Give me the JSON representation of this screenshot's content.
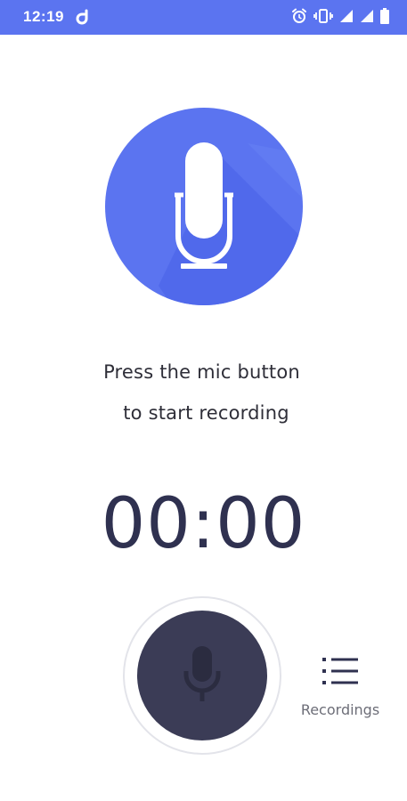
{
  "status_bar": {
    "time": "12:19",
    "icons": [
      "app-notification-icon",
      "alarm-icon",
      "vibrate-icon",
      "signal-icon",
      "signal-icon",
      "battery-icon"
    ],
    "background_color": "#5b74f0"
  },
  "hero": {
    "icon": "studio-microphone-icon",
    "background_color": "#5b74f0"
  },
  "prompt": {
    "line1": "Press the mic button",
    "line2": "to start recording"
  },
  "timer": {
    "value": "00:00"
  },
  "record_button": {
    "icon": "microphone-icon",
    "color": "#3b3c56"
  },
  "recordings": {
    "label": "Recordings",
    "icon": "list-icon"
  }
}
